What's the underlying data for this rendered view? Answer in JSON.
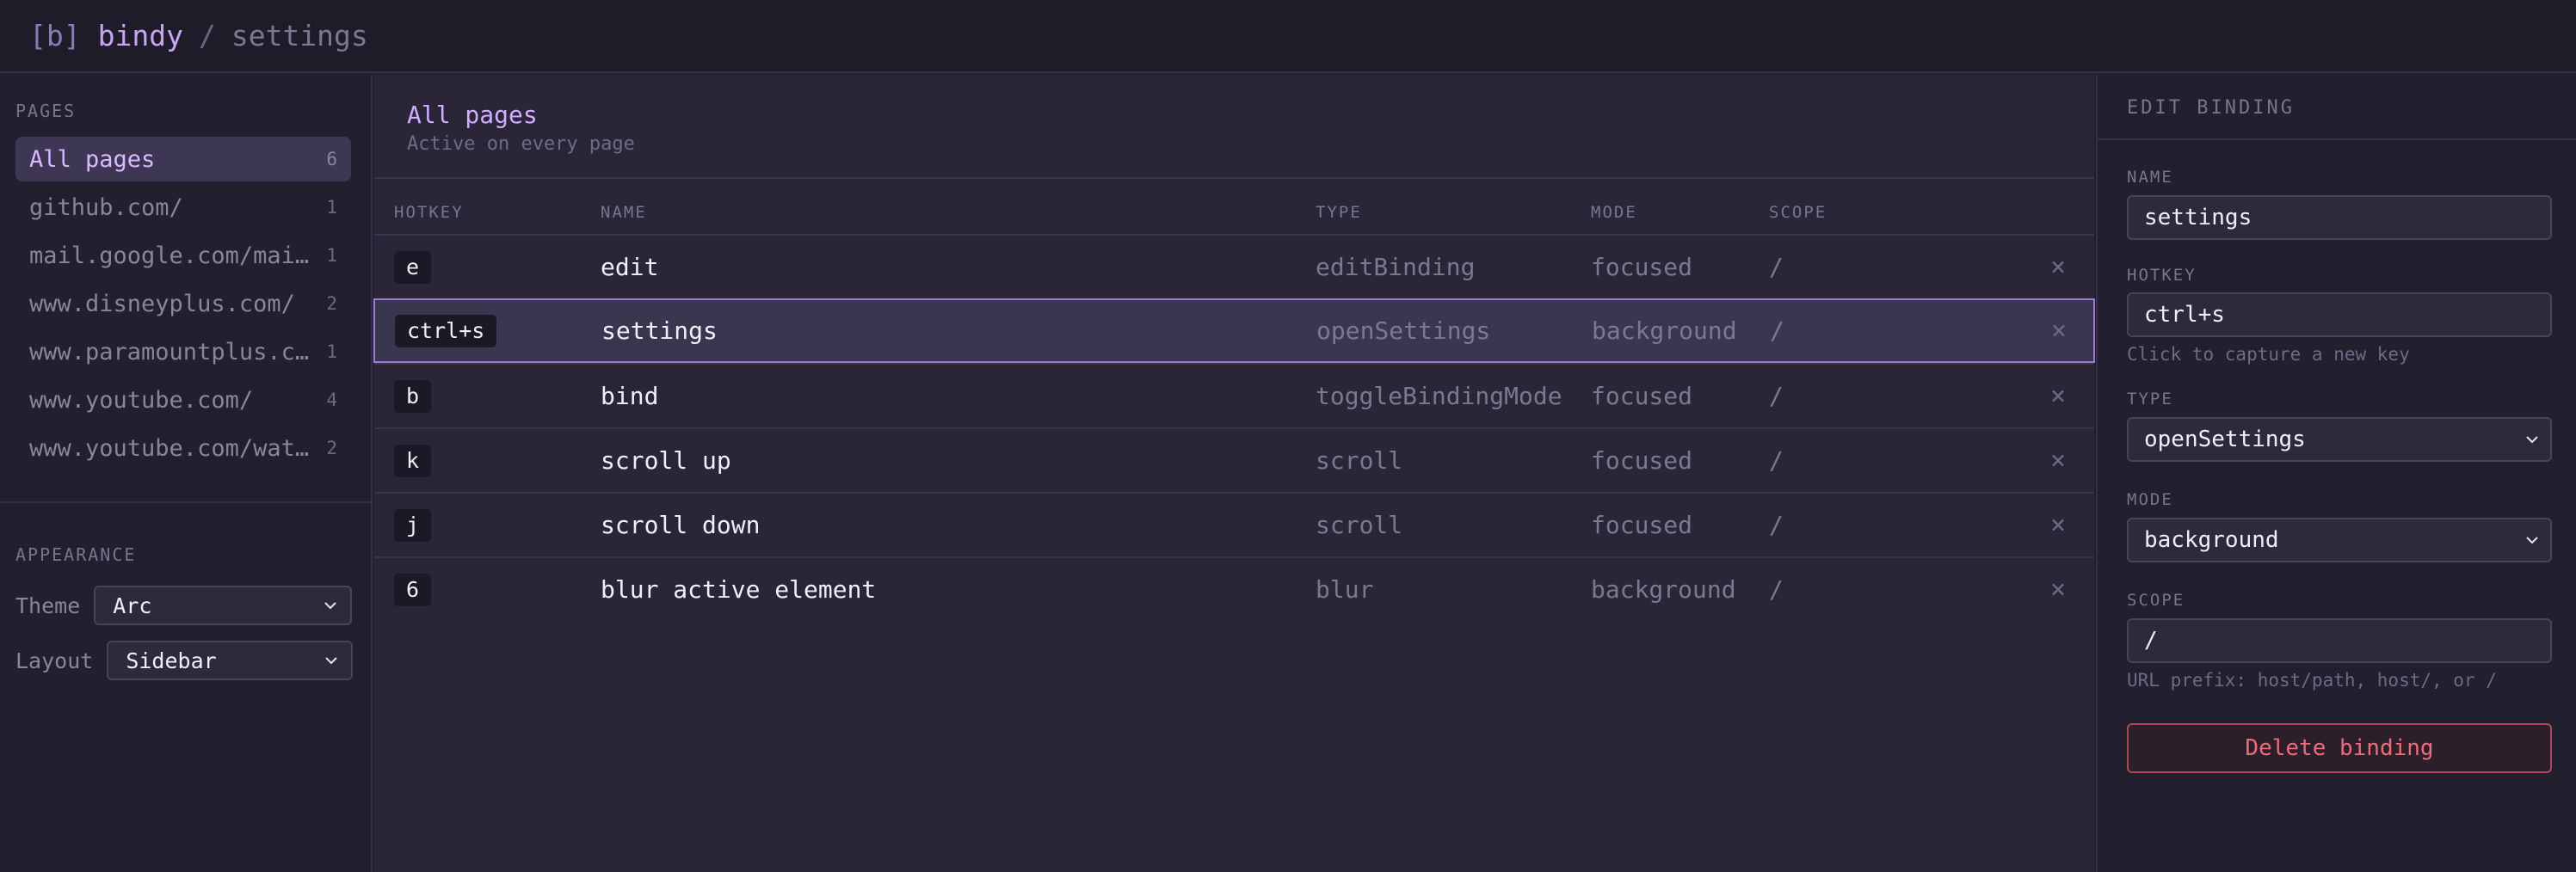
{
  "header": {
    "logo_open": "[",
    "logo_letter": "b",
    "logo_close": "]",
    "app_name": "bindy",
    "separator": "/",
    "current_page": "settings"
  },
  "sidebar": {
    "pages_heading": "PAGES",
    "pages": [
      {
        "label": "All pages",
        "count": "6"
      },
      {
        "label": "github.com/",
        "count": "1"
      },
      {
        "label": "mail.google.com/mail/",
        "count": "1"
      },
      {
        "label": "www.disneyplus.com/",
        "count": "2"
      },
      {
        "label": "www.paramountplus.com/",
        "count": "1"
      },
      {
        "label": "www.youtube.com/",
        "count": "4"
      },
      {
        "label": "www.youtube.com/watch",
        "count": "2"
      }
    ],
    "appearance_heading": "APPEARANCE",
    "theme_label": "Theme",
    "theme_value": "Arc",
    "layout_label": "Layout",
    "layout_value": "Sidebar"
  },
  "main": {
    "title": "All pages",
    "subtitle": "Active on every page",
    "columns": {
      "hotkey": "HOTKEY",
      "name": "NAME",
      "type": "TYPE",
      "mode": "MODE",
      "scope": "SCOPE"
    },
    "delete_glyph": "×",
    "rows": [
      {
        "hotkey": "e",
        "name": "edit",
        "type": "editBinding",
        "mode": "focused",
        "scope": "/"
      },
      {
        "hotkey": "ctrl+s",
        "name": "settings",
        "type": "openSettings",
        "mode": "background",
        "scope": "/"
      },
      {
        "hotkey": "b",
        "name": "bind",
        "type": "toggleBindingMode",
        "mode": "focused",
        "scope": "/"
      },
      {
        "hotkey": "k",
        "name": "scroll up",
        "type": "scroll",
        "mode": "focused",
        "scope": "/"
      },
      {
        "hotkey": "j",
        "name": "scroll down",
        "type": "scroll",
        "mode": "focused",
        "scope": "/"
      },
      {
        "hotkey": "6",
        "name": "blur active element",
        "type": "blur",
        "mode": "background",
        "scope": "/"
      }
    ],
    "selected_row": 1
  },
  "panel": {
    "title": "EDIT BINDING",
    "name_label": "NAME",
    "name_value": "settings",
    "hotkey_label": "HOTKEY",
    "hotkey_value": "ctrl+s",
    "hotkey_hint": "Click to capture a new key",
    "type_label": "TYPE",
    "type_value": "openSettings",
    "mode_label": "MODE",
    "mode_value": "background",
    "scope_label": "SCOPE",
    "scope_value": "/",
    "scope_hint": "URL prefix: host/path, host/, or /",
    "delete_label": "Delete binding"
  },
  "colors": {
    "accent": "#c9a6f5",
    "background": "#221f2e",
    "danger": "#f06a78"
  }
}
